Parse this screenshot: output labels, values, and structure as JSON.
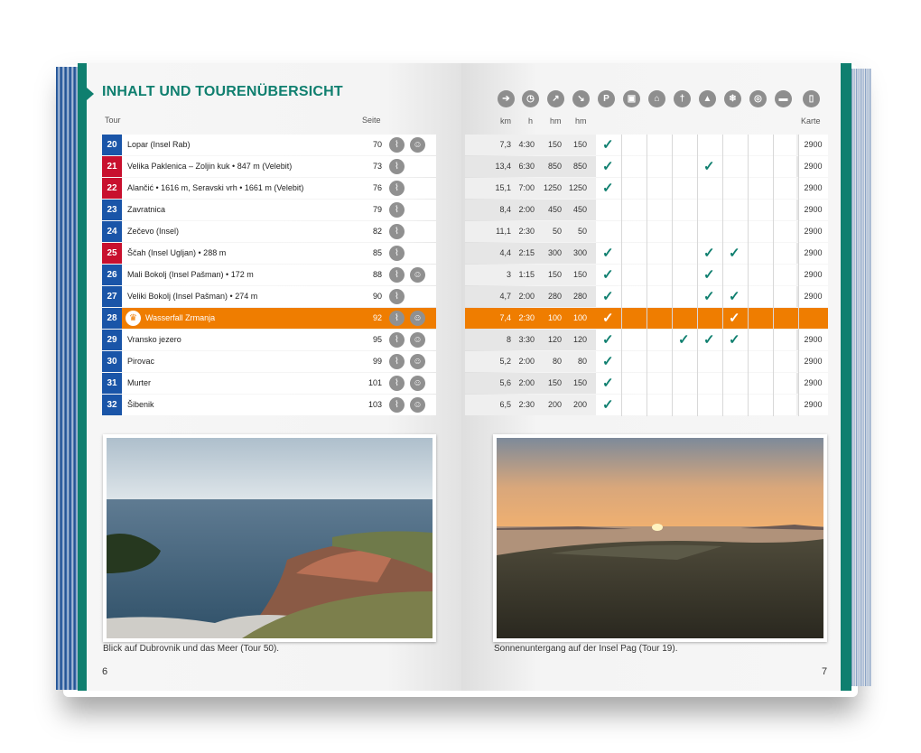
{
  "header": {
    "title": "INHALT UND TOURENÜBERSICHT",
    "col_tour": "Tour",
    "col_seite": "Seite",
    "col_km": "km",
    "col_h": "h",
    "col_hm1": "hm",
    "col_hm2": "hm",
    "col_karte": "Karte",
    "parking_letter": "P"
  },
  "icons": [
    "signpost-icon",
    "clock-icon",
    "uphill-icon",
    "downhill-icon",
    "parking-icon",
    "bus-icon",
    "cablecar-icon",
    "restaurant-icon",
    "summit-icon",
    "winter-icon",
    "bike-icon",
    "bed-icon",
    "map-icon"
  ],
  "tours": [
    {
      "nr": "20",
      "color": "#1a55a8",
      "name": "Lopar (Insel Rab)",
      "seite": "70",
      "km": "7,3",
      "h": "4:30",
      "hm1": "150",
      "hm2": "150",
      "karte": "2900",
      "checks": [
        0
      ]
    },
    {
      "nr": "21",
      "color": "#c8102e",
      "name": "Velika Paklenica – Zoljin kuk • 847 m (Velebit)",
      "seite": "73",
      "km": "13,4",
      "h": "6:30",
      "hm1": "850",
      "hm2": "850",
      "karte": "2900",
      "checks": [
        0,
        4
      ]
    },
    {
      "nr": "22",
      "color": "#c8102e",
      "name": "Alančić • 1616 m, Seravski vrh • 1661 m (Velebit)",
      "seite": "76",
      "km": "15,1",
      "h": "7:00",
      "hm1": "1250",
      "hm2": "1250",
      "karte": "2900",
      "checks": [
        0
      ]
    },
    {
      "nr": "23",
      "color": "#1a55a8",
      "name": "Zavratnica",
      "seite": "79",
      "km": "8,4",
      "h": "2:00",
      "hm1": "450",
      "hm2": "450",
      "karte": "2900",
      "checks": []
    },
    {
      "nr": "24",
      "color": "#1a55a8",
      "name": "Zečevo (Insel)",
      "seite": "82",
      "km": "11,1",
      "h": "2:30",
      "hm1": "50",
      "hm2": "50",
      "karte": "2900",
      "checks": []
    },
    {
      "nr": "25",
      "color": "#c8102e",
      "name": "Ščah (Insel Ugljan) • 288 m",
      "seite": "85",
      "km": "4,4",
      "h": "2:15",
      "hm1": "300",
      "hm2": "300",
      "karte": "2900",
      "checks": [
        0,
        4,
        5
      ]
    },
    {
      "nr": "26",
      "color": "#1a55a8",
      "name": "Mali Bokolj (Insel Pašman) • 172 m",
      "seite": "88",
      "km": "3",
      "h": "1:15",
      "hm1": "150",
      "hm2": "150",
      "karte": "2900",
      "checks": [
        0,
        4
      ]
    },
    {
      "nr": "27",
      "color": "#1a55a8",
      "name": "Veliki Bokolj (Insel Pašman) • 274 m",
      "seite": "90",
      "km": "4,7",
      "h": "2:00",
      "hm1": "280",
      "hm2": "280",
      "karte": "2900",
      "checks": [
        0,
        4,
        5
      ]
    },
    {
      "nr": "28",
      "color": "#1a55a8",
      "name": "Wasserfall Zrmanja",
      "seite": "92",
      "km": "7,4",
      "h": "2:30",
      "hm1": "100",
      "hm2": "100",
      "karte": "",
      "checks": [
        0,
        5
      ],
      "highlight": true
    },
    {
      "nr": "29",
      "color": "#1a55a8",
      "name": "Vransko jezero",
      "seite": "95",
      "km": "8",
      "h": "3:30",
      "hm1": "120",
      "hm2": "120",
      "karte": "2900",
      "checks": [
        0,
        3,
        4,
        5
      ]
    },
    {
      "nr": "30",
      "color": "#1a55a8",
      "name": "Pirovac",
      "seite": "99",
      "km": "5,2",
      "h": "2:00",
      "hm1": "80",
      "hm2": "80",
      "karte": "2900",
      "checks": [
        0
      ]
    },
    {
      "nr": "31",
      "color": "#1a55a8",
      "name": "Murter",
      "seite": "101",
      "km": "5,6",
      "h": "2:00",
      "hm1": "150",
      "hm2": "150",
      "karte": "2900",
      "checks": [
        0
      ]
    },
    {
      "nr": "32",
      "color": "#1a55a8",
      "name": "Šibenik",
      "seite": "103",
      "km": "6,5",
      "h": "2:30",
      "hm1": "200",
      "hm2": "200",
      "karte": "2900",
      "checks": [
        0
      ]
    }
  ],
  "captions": {
    "left": "Blick auf Dubrovnik und das Meer (Tour 50).",
    "right": "Sonnenuntergang auf der Insel Pag (Tour 19)."
  },
  "page_numbers": {
    "left": "6",
    "right": "7"
  },
  "check_symbol": "✓",
  "colors": {
    "teal": "#0f7f6f",
    "blue": "#1a55a8",
    "red": "#c8102e",
    "highlight": "#ef7d00"
  }
}
